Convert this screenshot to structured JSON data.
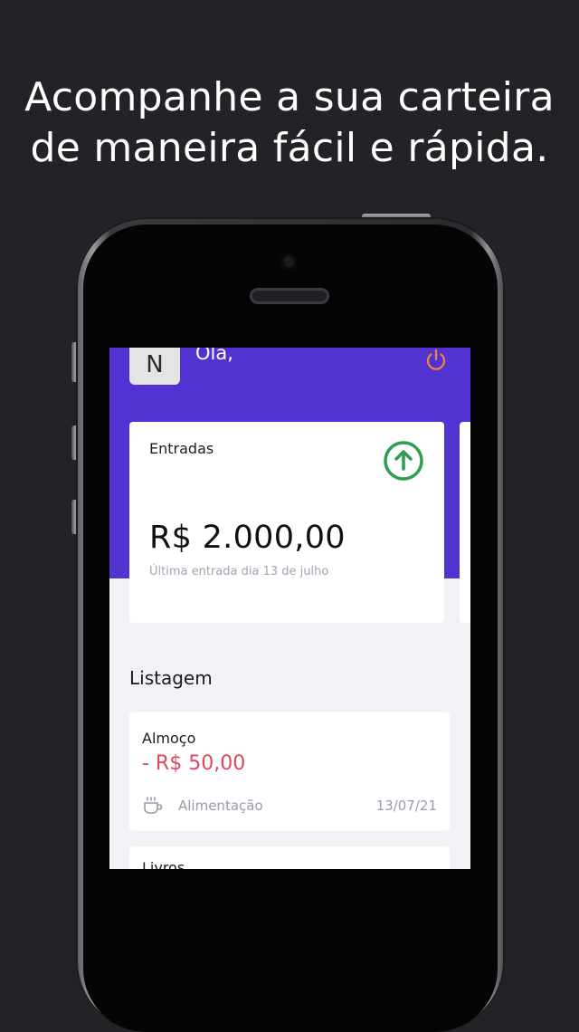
{
  "headline": {
    "line1": "Acompanhe a sua carteira",
    "line2": "de maneira fácil e rápida."
  },
  "header": {
    "avatar_initial": "N",
    "greeting": "Olá,",
    "power_icon": "power-icon",
    "background_color": "#5233d2"
  },
  "income_card": {
    "label": "Entradas",
    "icon": "arrow-up-circle-icon",
    "icon_color": "#2e9e52",
    "amount": "R$ 2.000,00",
    "subtitle": "Última entrada dia 13 de julho"
  },
  "listing": {
    "title": "Listagem",
    "items": [
      {
        "title": "Almoço",
        "amount": "- R$ 50,00",
        "category_icon": "coffee-icon",
        "category": "Alimentação",
        "date": "13/07/21"
      },
      {
        "title": "Livros"
      }
    ]
  },
  "colors": {
    "expense": "#e0465e",
    "power_icon": "#f2833b"
  }
}
